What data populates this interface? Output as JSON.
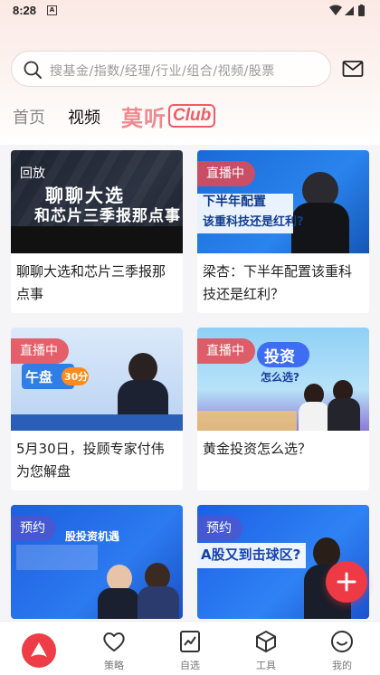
{
  "status_bar": {
    "time": "8:28",
    "app_badge": "A"
  },
  "search": {
    "placeholder": "搜基金/指数/经理/行业/组合/视频/股票"
  },
  "tabs": {
    "home": "首页",
    "video": "视频",
    "club_cn": "莫听",
    "club_en": "Club"
  },
  "cards": [
    {
      "status": "回放",
      "title": "聊聊大选和芯片三季报那点事",
      "thumb_text_1": "聊聊大选",
      "thumb_text_2": "和芯片三季报那点事"
    },
    {
      "status": "直播中",
      "title": "梁杏：下半年配置该重科技还是红利？",
      "thumb_text_1": "下半年配置",
      "thumb_text_2": "该重科技还是红利?"
    },
    {
      "status": "直播中",
      "title": "5月30日，投顾专家付伟为您解盘",
      "thumb_text_1": "午盘",
      "thumb_text_2": "30分"
    },
    {
      "status": "直播中",
      "title": "黄金投资怎么选？",
      "thumb_text_1": "投资",
      "thumb_text_2": "怎么选?"
    },
    {
      "status": "预约",
      "title": "",
      "thumb_text_1": "股投资机遇",
      "thumb_text_2": ""
    },
    {
      "status": "预约",
      "title": "",
      "thumb_text_1": "A股又到击球区?",
      "thumb_text_2": ""
    }
  ],
  "nav": {
    "strategy": "策略",
    "watchlist": "自选",
    "tools": "工具",
    "mine": "我的"
  },
  "colors": {
    "accent": "#ef3d47",
    "live_badge": "#e84850"
  }
}
